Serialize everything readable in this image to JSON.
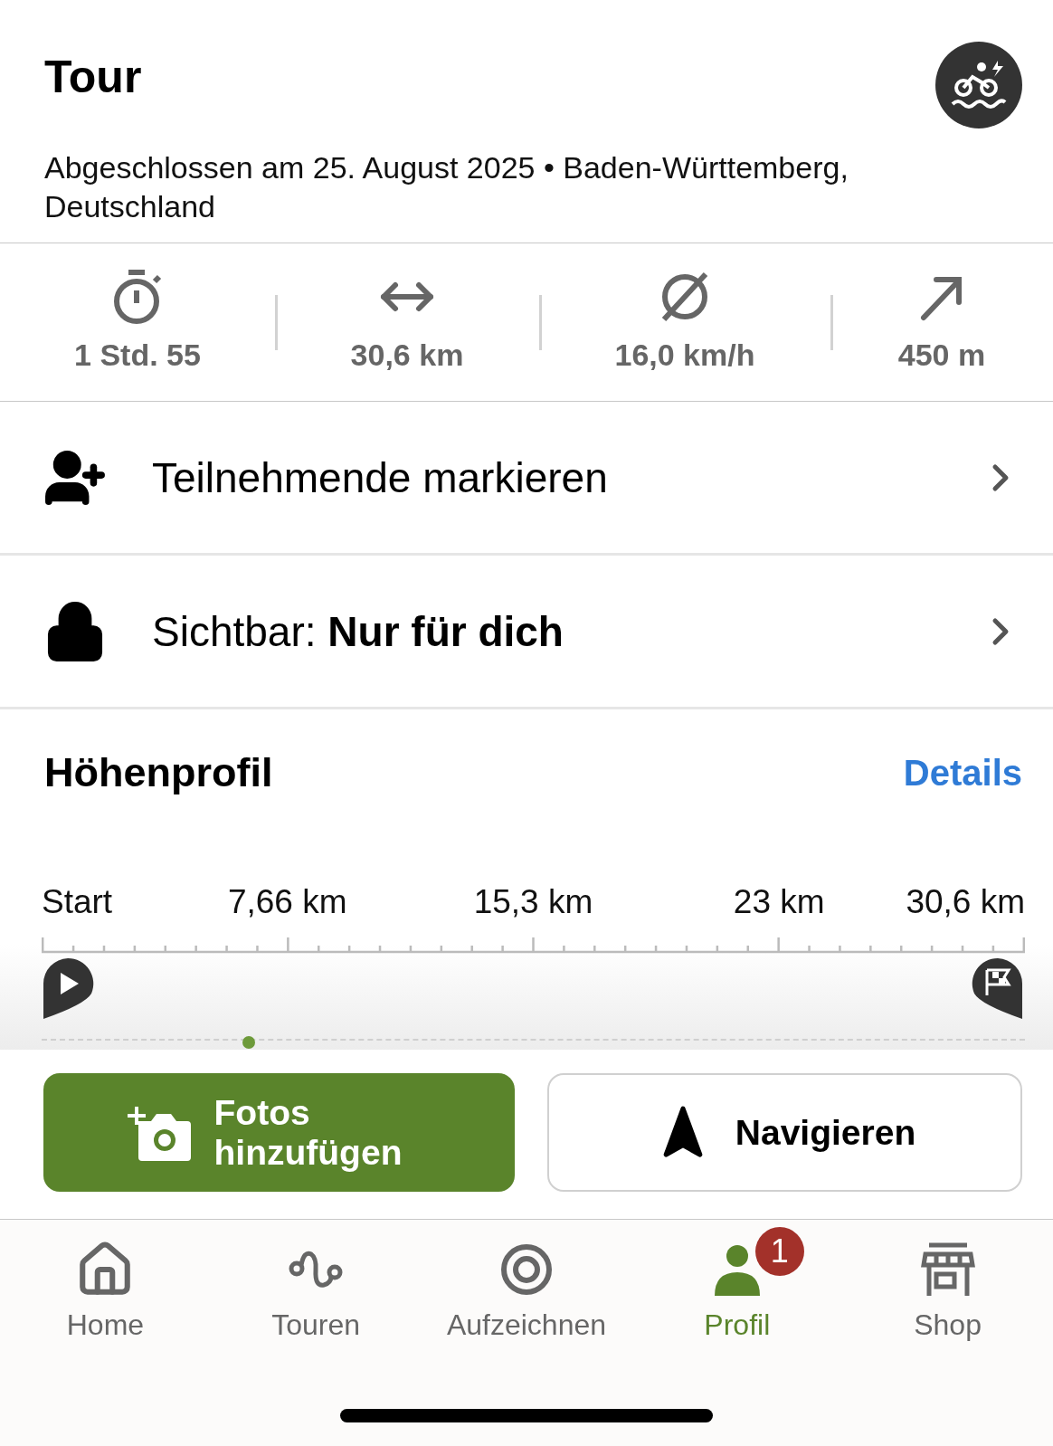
{
  "header": {
    "title": "Tour",
    "subtitle": "Abgeschlossen am 25. August 2025 • Baden-Württemberg, Deutschland"
  },
  "stats": [
    {
      "kind": "duration",
      "value": "1 Std. 55"
    },
    {
      "kind": "distance",
      "value": "30,6 km"
    },
    {
      "kind": "speed",
      "value": "16,0 km/h"
    },
    {
      "kind": "ascent",
      "value": "450 m"
    }
  ],
  "actions": [
    {
      "kind": "participants",
      "label": "Teilnehmende markieren"
    },
    {
      "kind": "visibility",
      "label": "Sichtbar: **Nur für dich**"
    }
  ],
  "elevation": {
    "title": "Höhenprofil",
    "link": "Details",
    "axis_labels": [
      "Start",
      "7,66 km",
      "15,3 km",
      "23 km",
      "30,6 km"
    ]
  },
  "buttons": [
    {
      "kind": "primary",
      "label": "Fotos hinzufügen"
    },
    {
      "kind": "secondary",
      "label": "Navigieren"
    }
  ],
  "nav": [
    {
      "kind": "home",
      "label": "Home",
      "selected": false
    },
    {
      "kind": "tours",
      "label": "Touren",
      "selected": false
    },
    {
      "kind": "record",
      "label": "Aufzeichnen",
      "selected": false
    },
    {
      "kind": "profile",
      "label": "Profil",
      "selected": true,
      "badge": "1"
    },
    {
      "kind": "shop",
      "label": "Shop",
      "selected": false
    }
  ]
}
